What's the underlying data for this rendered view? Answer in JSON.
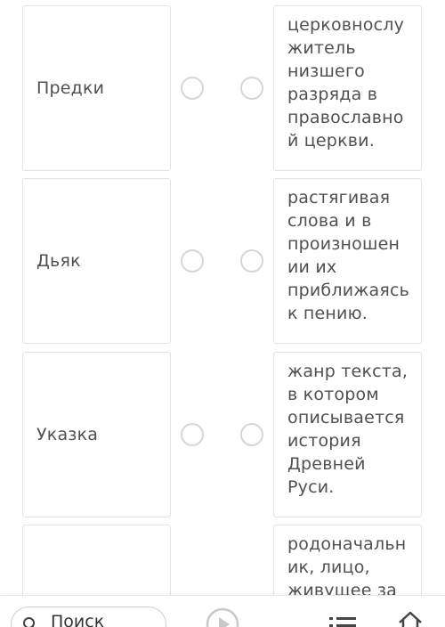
{
  "pairs": [
    {
      "term": "Предки",
      "definition": "церковнослу\nжитель\nнизшего\nразряда в\nправославно\nй церкви."
    },
    {
      "term": "Дьяк",
      "definition": "растягивая\nслова и в\nпроизношен\nии их\nприближаясь\nк пению."
    },
    {
      "term": "Указка",
      "definition": "жанр текста,\nв котором\nописывается\nистория\nДревней\nРуси."
    },
    {
      "term": "",
      "definition": "родоначальн\nик, лицо,\nживущее за"
    }
  ],
  "bottom_bar": {
    "search_label": "Поиск",
    "icons": [
      "search-icon",
      "play-icon",
      "list-icon",
      "home-icon"
    ]
  },
  "colors": {
    "card_border": "#e3e3e3",
    "radio_border": "#d6d6d6",
    "text": "#505050"
  }
}
